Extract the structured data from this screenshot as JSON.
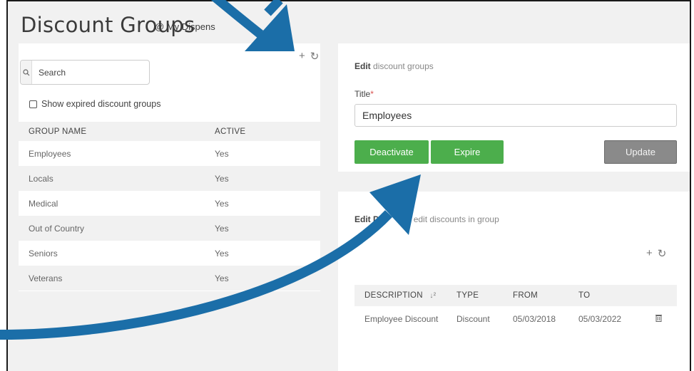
{
  "page": {
    "title": "Discount Groups",
    "subtitle": "@ My Dispens"
  },
  "groups_panel": {
    "search_placeholder": "Search",
    "show_expired_label": "Show expired discount groups",
    "columns": [
      "GROUP NAME",
      "ACTIVE"
    ],
    "rows": [
      {
        "name": "Employees",
        "active": "Yes"
      },
      {
        "name": "Locals",
        "active": "Yes"
      },
      {
        "name": "Medical",
        "active": "Yes"
      },
      {
        "name": "Out of Country",
        "active": "Yes"
      },
      {
        "name": "Seniors",
        "active": "Yes"
      },
      {
        "name": "Veterans",
        "active": "Yes"
      }
    ]
  },
  "edit_panel": {
    "heading_bold": "Edit",
    "heading_rest": "discount groups",
    "title_label": "Title",
    "required_mark": "*",
    "title_value": "Employees",
    "deactivate_label": "Deactivate",
    "expire_label": "Expire",
    "update_label": "Update"
  },
  "discounts_panel": {
    "heading_bold": "Edit Di",
    "heading_rest": "edit discounts in group",
    "columns": [
      "DESCRIPTION",
      "TYPE",
      "FROM",
      "TO"
    ],
    "rows": [
      {
        "description": "Employee Discount",
        "type": "Discount",
        "from": "05/03/2018",
        "to": "05/03/2022"
      }
    ]
  },
  "icons": {
    "add": "plus-icon",
    "refresh": "refresh-icon",
    "search": "search-icon",
    "sort": "sort-icon",
    "delete": "trash-icon"
  },
  "colors": {
    "accent_green": "#4cae4c",
    "update_gray": "#8a8a8a",
    "arrow_blue": "#1b6ea8",
    "required_red": "#d9534f"
  }
}
